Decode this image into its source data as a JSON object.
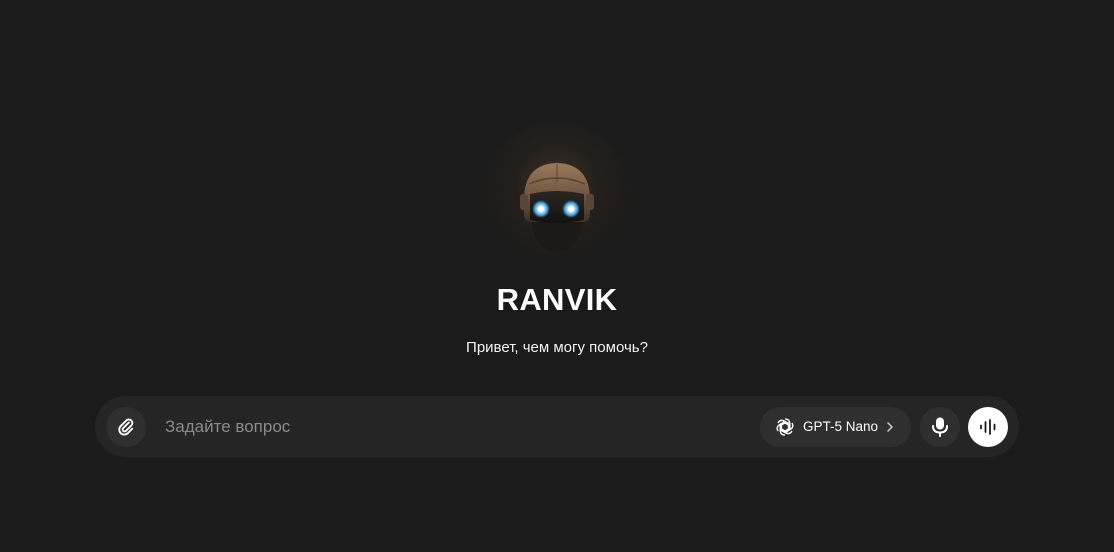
{
  "app": {
    "title": "RANVIK",
    "greeting": "Привет, чем могу помочь?"
  },
  "composer": {
    "placeholder": "Задайте вопрос",
    "value": "",
    "attach_icon": "paperclip-icon",
    "model": {
      "label": "GPT-5 Nano",
      "icon": "openai-logo-icon",
      "chevron_icon": "chevron-right-icon"
    },
    "mic_icon": "microphone-icon",
    "voice_icon": "voice-waveform-icon"
  },
  "colors": {
    "background": "#1b1b1b",
    "composer_bg": "#252525",
    "button_bg": "#2f2f2f",
    "voice_button_bg": "#ffffff",
    "text": "#ffffff",
    "placeholder": "#8a8a8a"
  }
}
